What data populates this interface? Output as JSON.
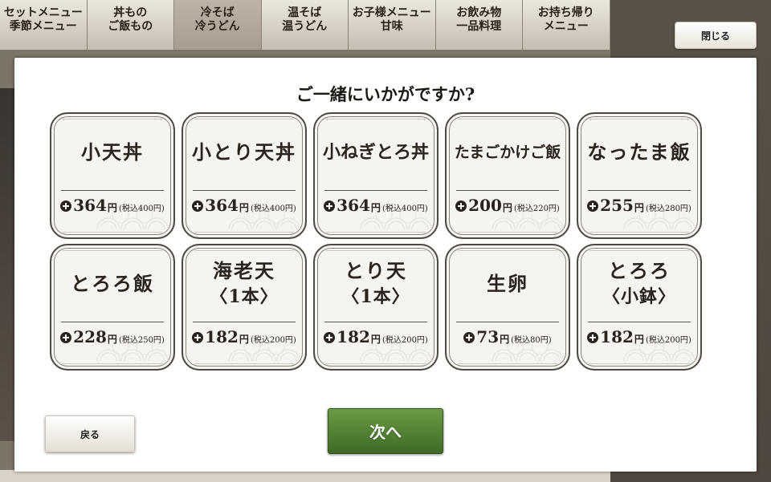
{
  "tabs": [
    {
      "line1": "セットメニュー",
      "line2": "季節メニュー"
    },
    {
      "line1": "丼もの",
      "line2": "ご飯もの"
    },
    {
      "line1": "冷そば",
      "line2": "冷うどん"
    },
    {
      "line1": "温そば",
      "line2": "温うどん"
    },
    {
      "line1": "お子様メニュー",
      "line2": "甘味"
    },
    {
      "line1": "お飲み物",
      "line2": "一品料理"
    },
    {
      "line1": "お持ち帰り",
      "line2": "メニュー"
    }
  ],
  "close_label": "閉じる",
  "modal": {
    "title": "ご一緒にいかがですか?",
    "back_label": "戻る",
    "next_label": "次へ"
  },
  "items": [
    {
      "name": "小天丼",
      "sub": "",
      "price": "364",
      "yen": "円",
      "tax": "(税込400円)"
    },
    {
      "name": "小とり天丼",
      "sub": "",
      "price": "364",
      "yen": "円",
      "tax": "(税込400円)"
    },
    {
      "name": "小ねぎとろ丼",
      "sub": "",
      "price": "364",
      "yen": "円",
      "tax": "(税込400円)"
    },
    {
      "name": "たまごかけご飯",
      "sub": "",
      "price": "200",
      "yen": "円",
      "tax": "(税込220円)"
    },
    {
      "name": "なったま飯",
      "sub": "",
      "price": "255",
      "yen": "円",
      "tax": "(税込280円)"
    },
    {
      "name": "とろろ飯",
      "sub": "",
      "price": "228",
      "yen": "円",
      "tax": "(税込250円)"
    },
    {
      "name": "海老天",
      "sub": "〈1本〉",
      "price": "182",
      "yen": "円",
      "tax": "(税込200円)"
    },
    {
      "name": "とり天",
      "sub": "〈1本〉",
      "price": "182",
      "yen": "円",
      "tax": "(税込200円)"
    },
    {
      "name": "生卵",
      "sub": "",
      "price": "73",
      "yen": "円",
      "tax": "(税込80円)"
    },
    {
      "name": "とろろ",
      "sub": "〈小鉢〉",
      "price": "182",
      "yen": "円",
      "tax": "(税込200円)"
    }
  ]
}
